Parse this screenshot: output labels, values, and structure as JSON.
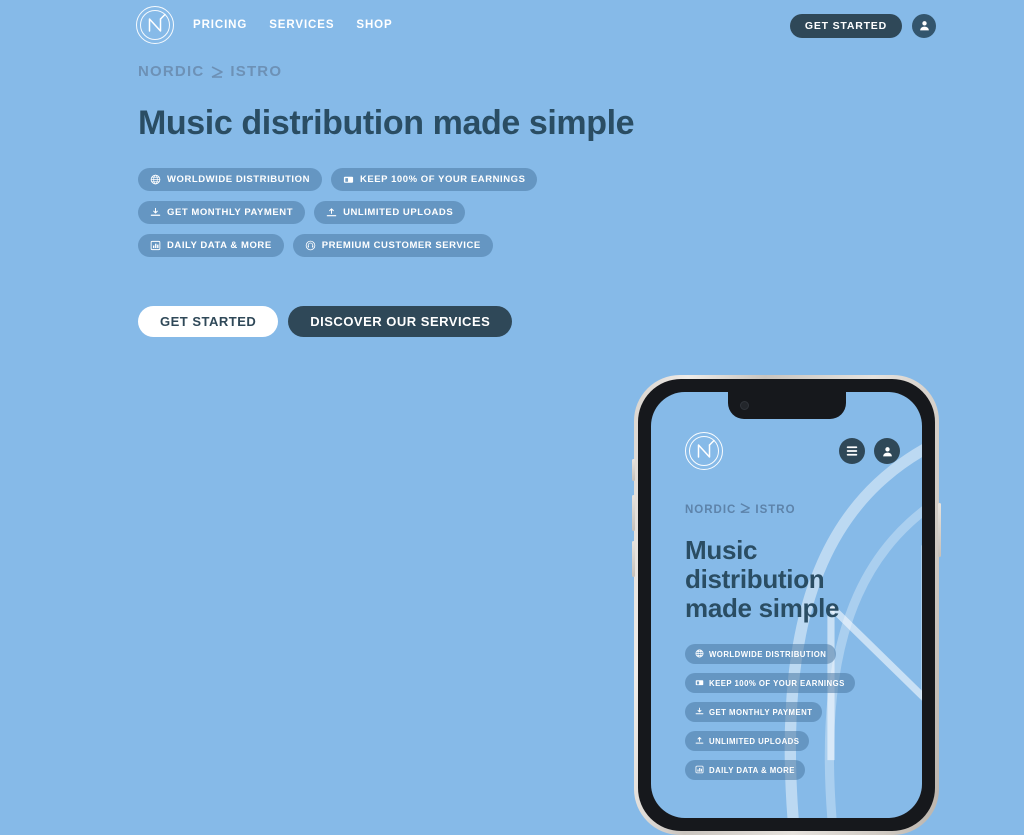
{
  "colors": {
    "background": "#86bae8",
    "dark": "#2f4858",
    "headline": "#2a4d63",
    "pill": "rgba(71,116,160,0.52)",
    "wordmark": "#6d91b6",
    "white": "#ffffff"
  },
  "nav": {
    "logo_alt": "Nordic Distro logo",
    "links": [
      {
        "label": "PRICING"
      },
      {
        "label": "SERVICES"
      },
      {
        "label": "SHOP"
      }
    ],
    "cta_label": "GET STARTED",
    "avatar_icon": "user-icon"
  },
  "hero": {
    "wordmark_part1": "NORDIC",
    "wordmark_part2": "ISTRO",
    "headline": "Music distribution made simple",
    "pill_rows": [
      [
        {
          "label": "WORLDWIDE DISTRIBUTION",
          "icon": "globe-icon"
        },
        {
          "label": "KEEP 100% OF YOUR EARNINGS",
          "icon": "money-icon"
        }
      ],
      [
        {
          "label": "GET MONTHLY PAYMENT",
          "icon": "download-icon"
        },
        {
          "label": "UNLIMITED UPLOADS",
          "icon": "upload-icon"
        }
      ],
      [
        {
          "label": "DAILY DATA & MORE",
          "icon": "bar-chart-icon"
        },
        {
          "label": "PREMIUM CUSTOMER SERVICE",
          "icon": "headset-icon"
        }
      ]
    ],
    "buttons": [
      {
        "label": "GET STARTED",
        "style": "light"
      },
      {
        "label": "DISCOVER OUR SERVICES",
        "style": "dark"
      }
    ]
  },
  "phone": {
    "logo_alt": "Nordic Distro logo",
    "menu_icon": "hamburger-menu-icon",
    "avatar_icon": "user-icon",
    "wordmark_part1": "NORDIC",
    "wordmark_part2": "ISTRO",
    "headline_line1": "Music",
    "headline_line2": "distribution",
    "headline_line3": "made simple",
    "pills": [
      {
        "label": "WORLDWIDE DISTRIBUTION",
        "icon": "globe-icon"
      },
      {
        "label": "KEEP 100% OF YOUR EARNINGS",
        "icon": "money-icon"
      },
      {
        "label": "GET MONTHLY PAYMENT",
        "icon": "download-icon"
      },
      {
        "label": "UNLIMITED UPLOADS",
        "icon": "upload-icon"
      },
      {
        "label": "DAILY DATA & MORE",
        "icon": "bar-chart-icon"
      }
    ]
  }
}
